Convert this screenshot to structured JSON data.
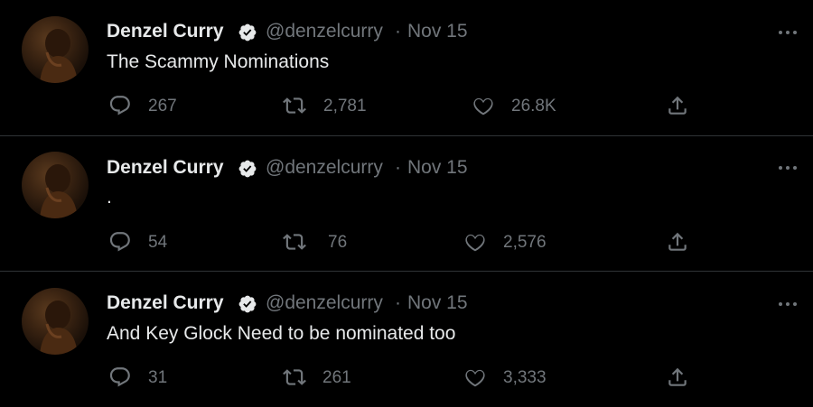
{
  "tweets": [
    {
      "display_name": "Denzel Curry",
      "handle": "@denzelcurry",
      "separator": "·",
      "date": "Nov 15",
      "text": "The Scammy Nominations",
      "replies": "267",
      "retweets": "2,781",
      "likes": "26.8K"
    },
    {
      "display_name": "Denzel Curry",
      "handle": "@denzelcurry",
      "separator": "·",
      "date": "Nov 15",
      "text": ".",
      "replies": "54",
      "retweets": "76",
      "likes": "2,576"
    },
    {
      "display_name": "Denzel Curry",
      "handle": "@denzelcurry",
      "separator": "·",
      "date": "Nov 15",
      "text": "And Key Glock Need to be nominated too",
      "replies": "31",
      "retweets": "261",
      "likes": "3,333"
    }
  ],
  "icons": {
    "reply": "reply-icon",
    "retweet": "retweet-icon",
    "like": "heart-icon",
    "share": "share-icon",
    "more": "more-icon",
    "verified": "verified-badge-icon"
  },
  "colors": {
    "background": "#000000",
    "primary_text": "#e7e9ea",
    "secondary_text": "#71767b",
    "divider": "#2f3336"
  }
}
